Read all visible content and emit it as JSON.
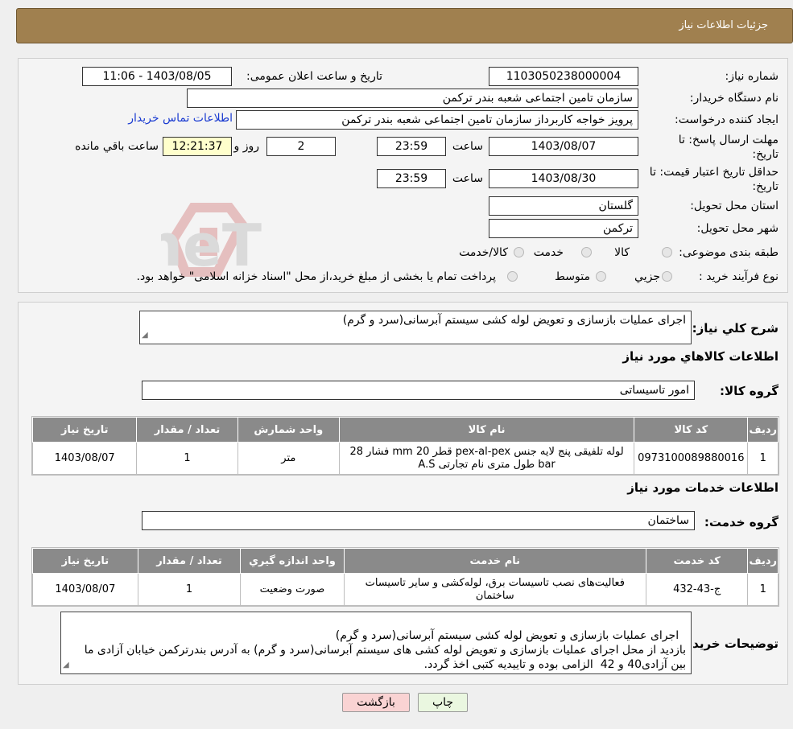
{
  "header": {
    "title": "جزئیات اطلاعات نیاز"
  },
  "labels": {
    "need_number": "شماره نیاز:",
    "announce_datetime": "تاریخ و ساعت اعلان عمومی:",
    "buyer_org": "نام دستگاه خریدار:",
    "requester": "ایجاد کننده درخواست:",
    "deadline": "مهلت ارسال پاسخ: تا تاریخ:",
    "min_validity": "حداقل تاریخ اعتبار قیمت: تا تاریخ:",
    "hour": "ساعت",
    "day_and": "روز و",
    "remaining": "ساعت باقي مانده",
    "province": "استان محل تحویل:",
    "city": "شهر محل تحویل:",
    "category": "طبقه بندی موضوعی:",
    "purchase_type": "نوع فرآیند خرید :"
  },
  "values": {
    "need_number": "1103050238000004",
    "announce_datetime": "1403/08/05 - 11:06",
    "buyer_org": "سازمان تامین اجتماعی شعبه بندر ترکمن",
    "requester": "پرویز خواجه کاربرداز سازمان تامین اجتماعی شعبه بندر ترکمن",
    "contact_link": "اطلاعات تماس خریدار",
    "deadline_date": "1403/08/07",
    "deadline_time": "23:59",
    "days": "2",
    "remaining_time": "12:21:37",
    "validity_date": "1403/08/30",
    "validity_time": "23:59",
    "province": "گلستان",
    "city": "ترکمن"
  },
  "category_options": [
    "کالا",
    "خدمت",
    "کالا/خدمت"
  ],
  "purchase_options": [
    "جزيي",
    "متوسط"
  ],
  "purchase_note": "پرداخت تمام یا بخشی از مبلغ خرید،از محل \"اسناد خزانه اسلامی\" خواهد بود.",
  "summary": {
    "label": "شرح کلي نياز:",
    "text": "اجرای عملیات بازسازی و تعویض لوله کشی سیستم آبرسانی(سرد و گرم)"
  },
  "goods": {
    "title": "اطلاعات کالاهاي مورد نياز",
    "group_label": "گروه کالا:",
    "group_value": "امور تاسیساتی",
    "columns": [
      "رديف",
      "کد کالا",
      "نام کالا",
      "واحد شمارش",
      "تعداد / مقدار",
      "تاريخ نياز"
    ],
    "rows": [
      {
        "index": "1",
        "code": "0973100089880016",
        "name": "لوله تلفیقی پنج لایه جنس pex-al-pex قطر 20 mm فشار 28 bar طول متری نام تجارتی A.S",
        "unit": "متر",
        "qty": "1",
        "date": "1403/08/07"
      }
    ]
  },
  "services": {
    "title": "اطلاعات خدمات مورد نياز",
    "group_label": "گروه خدمت:",
    "group_value": "ساختمان",
    "columns": [
      "رديف",
      "کد خدمت",
      "نام خدمت",
      "واحد اندازه گيري",
      "تعداد / مقدار",
      "تاريخ نياز"
    ],
    "rows": [
      {
        "index": "1",
        "code": "ج-43-432",
        "name": "فعالیت‌های نصب تاسیسات برق، لوله‌کشی و سایر تاسیسات ساختمان",
        "unit": "صورت وضعیت",
        "qty": "1",
        "date": "1403/08/07"
      }
    ]
  },
  "buyer_notes": {
    "label": "توضیحات خریدار:",
    "text": "اجرای عملیات بازسازی و تعویض لوله کشی سیستم آبرسانی(سرد و گرم)\nبازدید از محل اجرای عملیات بازسازی و تعویض لوله کشی های سیستم آبرسانی(سرد و گرم) به آدرس بندرترکمن خیابان آزادی ما بین آزادی40 و 42  الزامی بوده و تاییدیه کتبی اخذ گردد."
  },
  "buttons": {
    "print": "چاپ",
    "back": "بازگشت"
  },
  "watermark": {
    "text": "AriaTender.neT"
  },
  "colors": {
    "header": "#a0804f",
    "table_header": "#8a8a8a",
    "print_btn": "#eaf7e0",
    "back_btn": "#f9d3d3",
    "link": "#1a3bd1"
  }
}
